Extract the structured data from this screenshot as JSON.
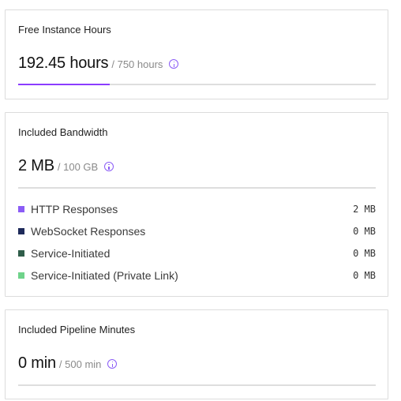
{
  "instance_hours": {
    "title": "Free Instance Hours",
    "used": "192.45 hours",
    "limit": "/ 750 hours",
    "usage_fraction": 0.2566
  },
  "bandwidth": {
    "title": "Included Bandwidth",
    "used": "2 MB",
    "limit": "/ 100 GB",
    "breakdown": [
      {
        "label": "HTTP Responses",
        "value": "2 MB",
        "color": "#8b5cf6"
      },
      {
        "label": "WebSocket Responses",
        "value": "0 MB",
        "color": "#1e2a5a"
      },
      {
        "label": "Service-Initiated",
        "value": "0 MB",
        "color": "#2f5d4a"
      },
      {
        "label": "Service-Initiated (Private Link)",
        "value": "0 MB",
        "color": "#6fd38a"
      }
    ]
  },
  "pipeline": {
    "title": "Included Pipeline Minutes",
    "used": "0 min",
    "limit": "/ 500 min",
    "usage_fraction": 0
  },
  "icons": {
    "info": "info-icon"
  },
  "colors": {
    "accent": "#8b3dff",
    "track": "#dedede"
  }
}
